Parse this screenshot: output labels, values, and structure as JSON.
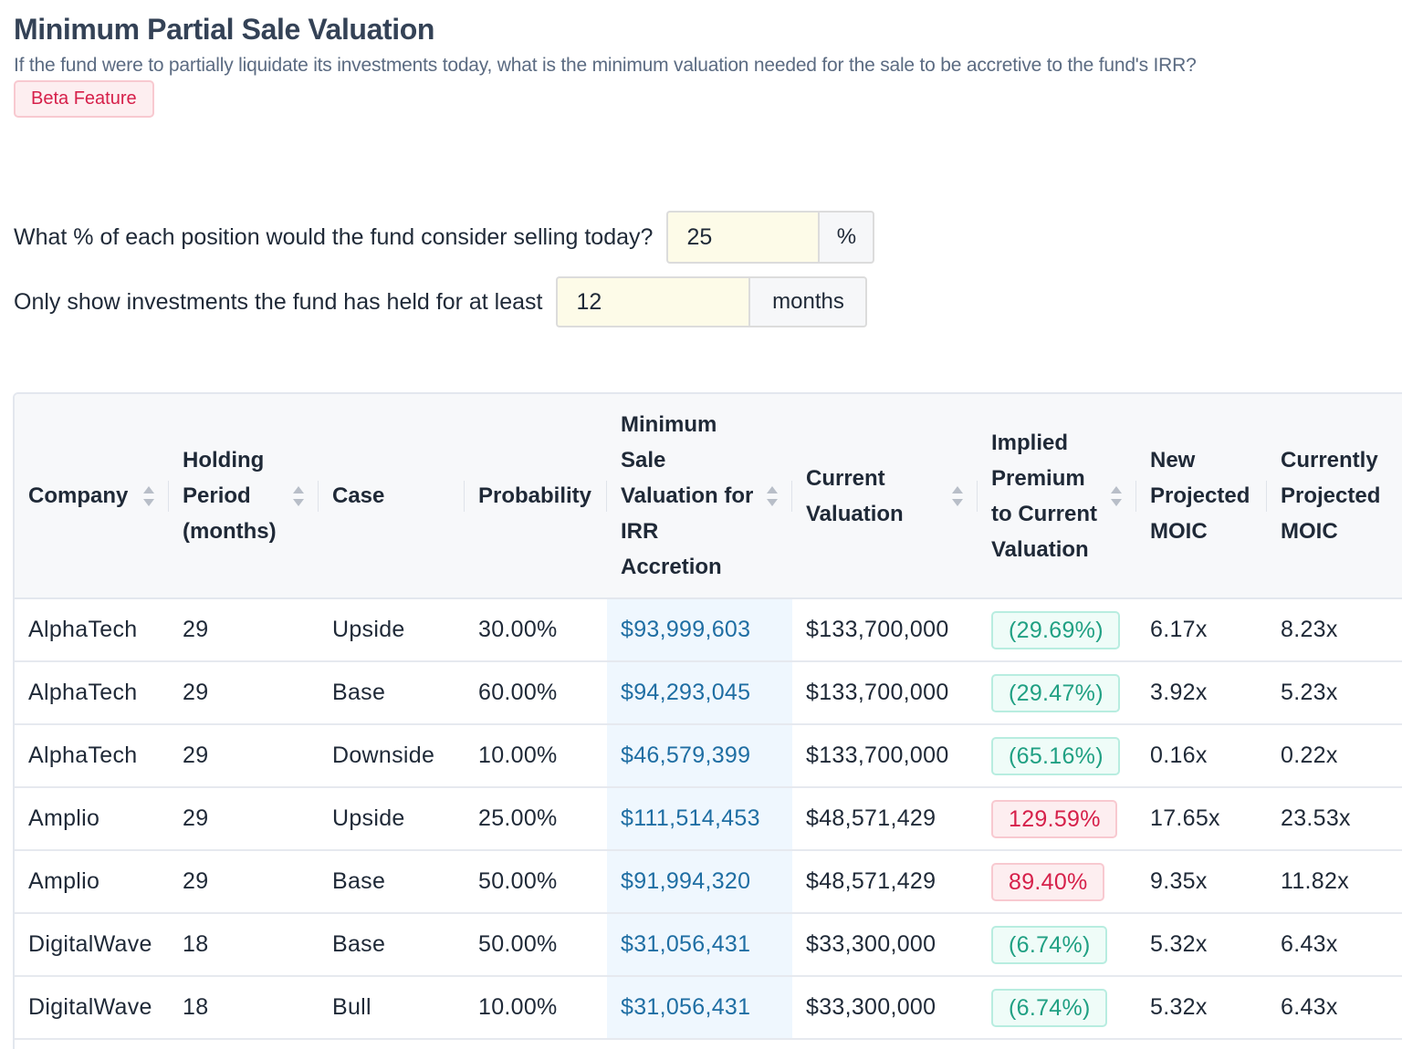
{
  "header": {
    "title": "Minimum Partial Sale Valuation",
    "subtitle": "If the fund were to partially liquidate its investments today, what is the minimum valuation needed for the sale to be accretive to the fund's IRR?",
    "badge": "Beta Feature"
  },
  "form": {
    "sell_pct": {
      "label": "What % of each position would the fund consider selling today?",
      "value": "25",
      "unit": "%"
    },
    "hold_months": {
      "label": "Only show investments the fund has held for at least",
      "value": "12",
      "unit": "months"
    }
  },
  "table": {
    "columns": [
      {
        "label": "Company",
        "sortable": true
      },
      {
        "label": "Holding Period (months)",
        "sortable": true
      },
      {
        "label": "Case",
        "sortable": false
      },
      {
        "label": "Probability",
        "sortable": false
      },
      {
        "label": "Minimum Sale Valuation for IRR Accretion",
        "sortable": true
      },
      {
        "label": "Current Valuation",
        "sortable": true
      },
      {
        "label": "Implied Premium to Current Valuation",
        "sortable": true
      },
      {
        "label": "New Projected MOIC",
        "sortable": false
      },
      {
        "label": "Currently Projected MOIC",
        "sortable": false
      }
    ],
    "rows": [
      {
        "company": "AlphaTech",
        "holding": "29",
        "case": "Upside",
        "probability": "30.00%",
        "min_valuation": "$93,999,603",
        "current_valuation": "$133,700,000",
        "premium": "(29.69%)",
        "premium_tone": "green",
        "new_moic": "6.17x",
        "current_moic": "8.23x"
      },
      {
        "company": "AlphaTech",
        "holding": "29",
        "case": "Base",
        "probability": "60.00%",
        "min_valuation": "$94,293,045",
        "current_valuation": "$133,700,000",
        "premium": "(29.47%)",
        "premium_tone": "green",
        "new_moic": "3.92x",
        "current_moic": "5.23x"
      },
      {
        "company": "AlphaTech",
        "holding": "29",
        "case": "Downside",
        "probability": "10.00%",
        "min_valuation": "$46,579,399",
        "current_valuation": "$133,700,000",
        "premium": "(65.16%)",
        "premium_tone": "green",
        "new_moic": "0.16x",
        "current_moic": "0.22x"
      },
      {
        "company": "Amplio",
        "holding": "29",
        "case": "Upside",
        "probability": "25.00%",
        "min_valuation": "$111,514,453",
        "current_valuation": "$48,571,429",
        "premium": "129.59%",
        "premium_tone": "red",
        "new_moic": "17.65x",
        "current_moic": "23.53x"
      },
      {
        "company": "Amplio",
        "holding": "29",
        "case": "Base",
        "probability": "50.00%",
        "min_valuation": "$91,994,320",
        "current_valuation": "$48,571,429",
        "premium": "89.40%",
        "premium_tone": "red",
        "new_moic": "9.35x",
        "current_moic": "11.82x"
      },
      {
        "company": "DigitalWave",
        "holding": "18",
        "case": "Base",
        "probability": "50.00%",
        "min_valuation": "$31,056,431",
        "current_valuation": "$33,300,000",
        "premium": "(6.74%)",
        "premium_tone": "green",
        "new_moic": "5.32x",
        "current_moic": "6.43x"
      },
      {
        "company": "DigitalWave",
        "holding": "18",
        "case": "Bull",
        "probability": "10.00%",
        "min_valuation": "$31,056,431",
        "current_valuation": "$33,300,000",
        "premium": "(6.74%)",
        "premium_tone": "green",
        "new_moic": "5.32x",
        "current_moic": "6.43x"
      }
    ]
  },
  "colors": {
    "title": "#344256",
    "badge_red": "#d6204a",
    "premium_green": "#20a083",
    "premium_red": "#d6204a",
    "min_valuation_blue": "#1f6ea3",
    "input_bg": "#fdfbe8"
  }
}
